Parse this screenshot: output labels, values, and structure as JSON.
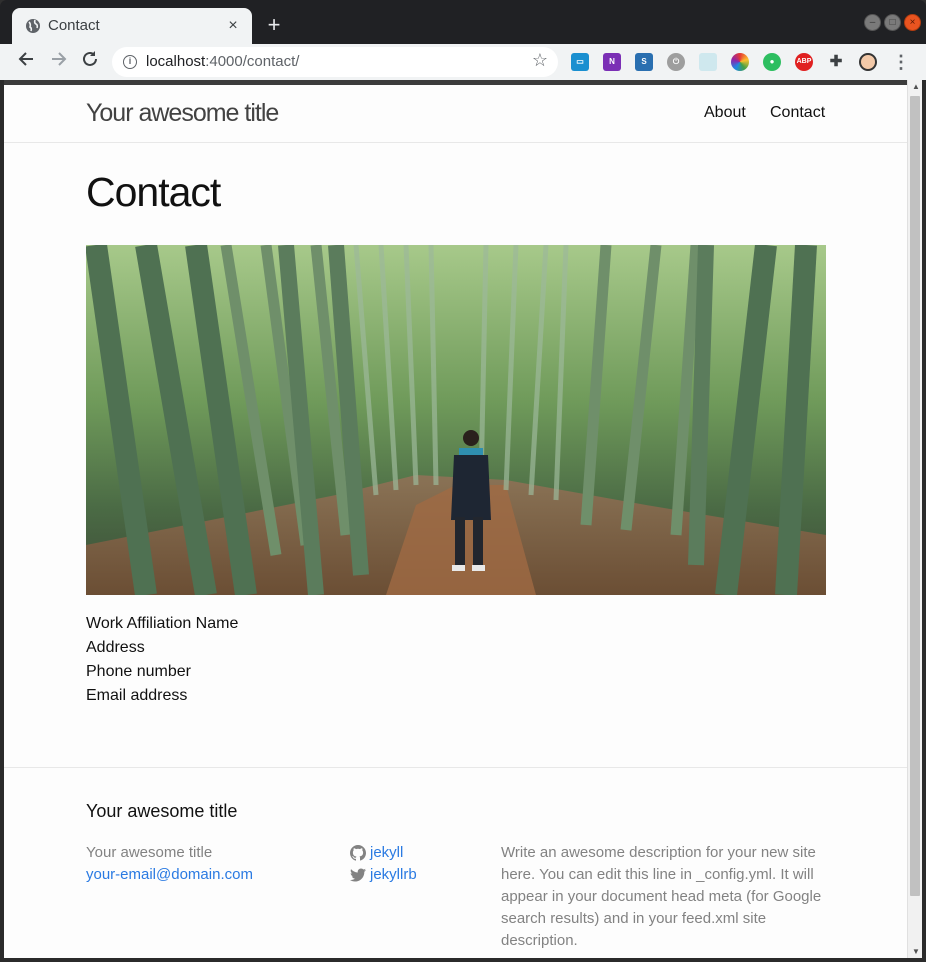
{
  "browser": {
    "tab_title": "Contact",
    "close_tab_glyph": "×",
    "new_tab_glyph": "+",
    "url_host": "localhost",
    "url_rest": ":4000/contact/",
    "extensions": [
      "reader-icon",
      "onenote-icon",
      "s-icon",
      "power-icon",
      "box-icon",
      "colorful-icon",
      "evernote-icon",
      "adblock-icon",
      "puzzle-icon",
      "profile-avatar"
    ],
    "adblock_label": "ABP",
    "onenote_label": "N"
  },
  "header": {
    "site_title": "Your awesome title",
    "nav": [
      "About",
      "Contact"
    ]
  },
  "page": {
    "title": "Contact",
    "hero_alt": "bamboo forest photo",
    "contact_lines": [
      "Work Affiliation Name",
      "Address",
      "Phone number",
      "Email address"
    ]
  },
  "footer": {
    "heading": "Your awesome title",
    "name": "Your awesome title",
    "email": "your-email@domain.com",
    "github": "jekyll",
    "twitter": "jekyllrb",
    "description": "Write an awesome description for your new site here. You can edit this line in _config.yml. It will appear in your document head meta (for Google search results) and in your feed.xml site description."
  },
  "colors": {
    "link": "#2a7ae2",
    "text": "#111111",
    "muted": "#828282",
    "header_border": "#e8e8e8"
  }
}
